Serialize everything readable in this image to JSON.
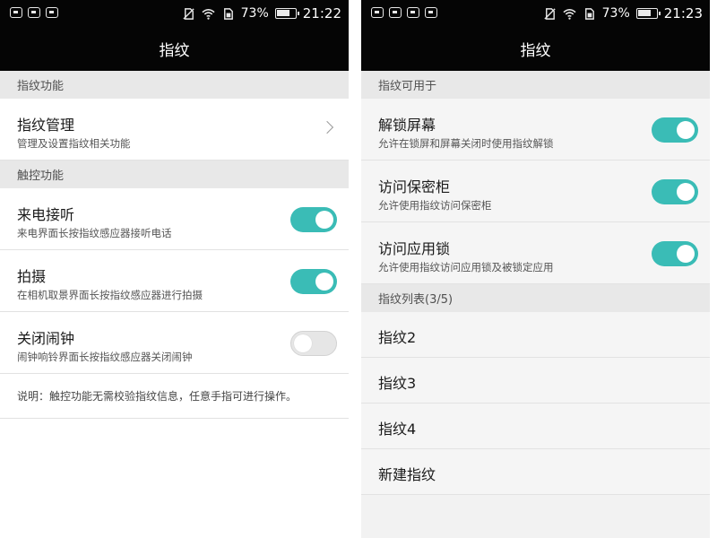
{
  "left": {
    "status": {
      "battery": "73%",
      "time": "21:22",
      "battery_level": 0.73
    },
    "title": "指纹",
    "sections": {
      "fp_function": "指纹功能",
      "touch_function": "触控功能"
    },
    "manage": {
      "title": "指纹管理",
      "subtitle": "管理及设置指纹相关功能"
    },
    "touch_items": [
      {
        "title": "来电接听",
        "subtitle": "来电界面长按指纹感应器接听电话",
        "on": true
      },
      {
        "title": "拍摄",
        "subtitle": "在相机取景界面长按指纹感应器进行拍摄",
        "on": true
      },
      {
        "title": "关闭闹钟",
        "subtitle": "闹钟响铃界面长按指纹感应器关闭闹钟",
        "on": false
      }
    ],
    "note": "说明：触控功能无需校验指纹信息，任意手指可进行操作。"
  },
  "right": {
    "status": {
      "battery": "73%",
      "time": "21:23",
      "battery_level": 0.73
    },
    "title": "指纹",
    "sections": {
      "usable_for": "指纹可用于",
      "fp_list": "指纹列表(3/5)"
    },
    "usage_items": [
      {
        "title": "解锁屏幕",
        "subtitle": "允许在锁屏和屏幕关闭时使用指纹解锁",
        "on": true
      },
      {
        "title": "访问保密柜",
        "subtitle": "允许使用指纹访问保密柜",
        "on": true
      },
      {
        "title": "访问应用锁",
        "subtitle": "允许使用指纹访问应用锁及被锁定应用",
        "on": true
      }
    ],
    "fingerprints": [
      "指纹2",
      "指纹3",
      "指纹4"
    ],
    "new_fingerprint": "新建指纹"
  },
  "colors": {
    "accent": "#3abcb6",
    "bar": "#050505",
    "section_bg": "#e8e8e8"
  },
  "icons": [
    "notification-icon",
    "keyboard-icon",
    "no-sim-icon",
    "wifi-icon",
    "sim-card-icon",
    "battery-icon",
    "chevron-right-icon"
  ]
}
